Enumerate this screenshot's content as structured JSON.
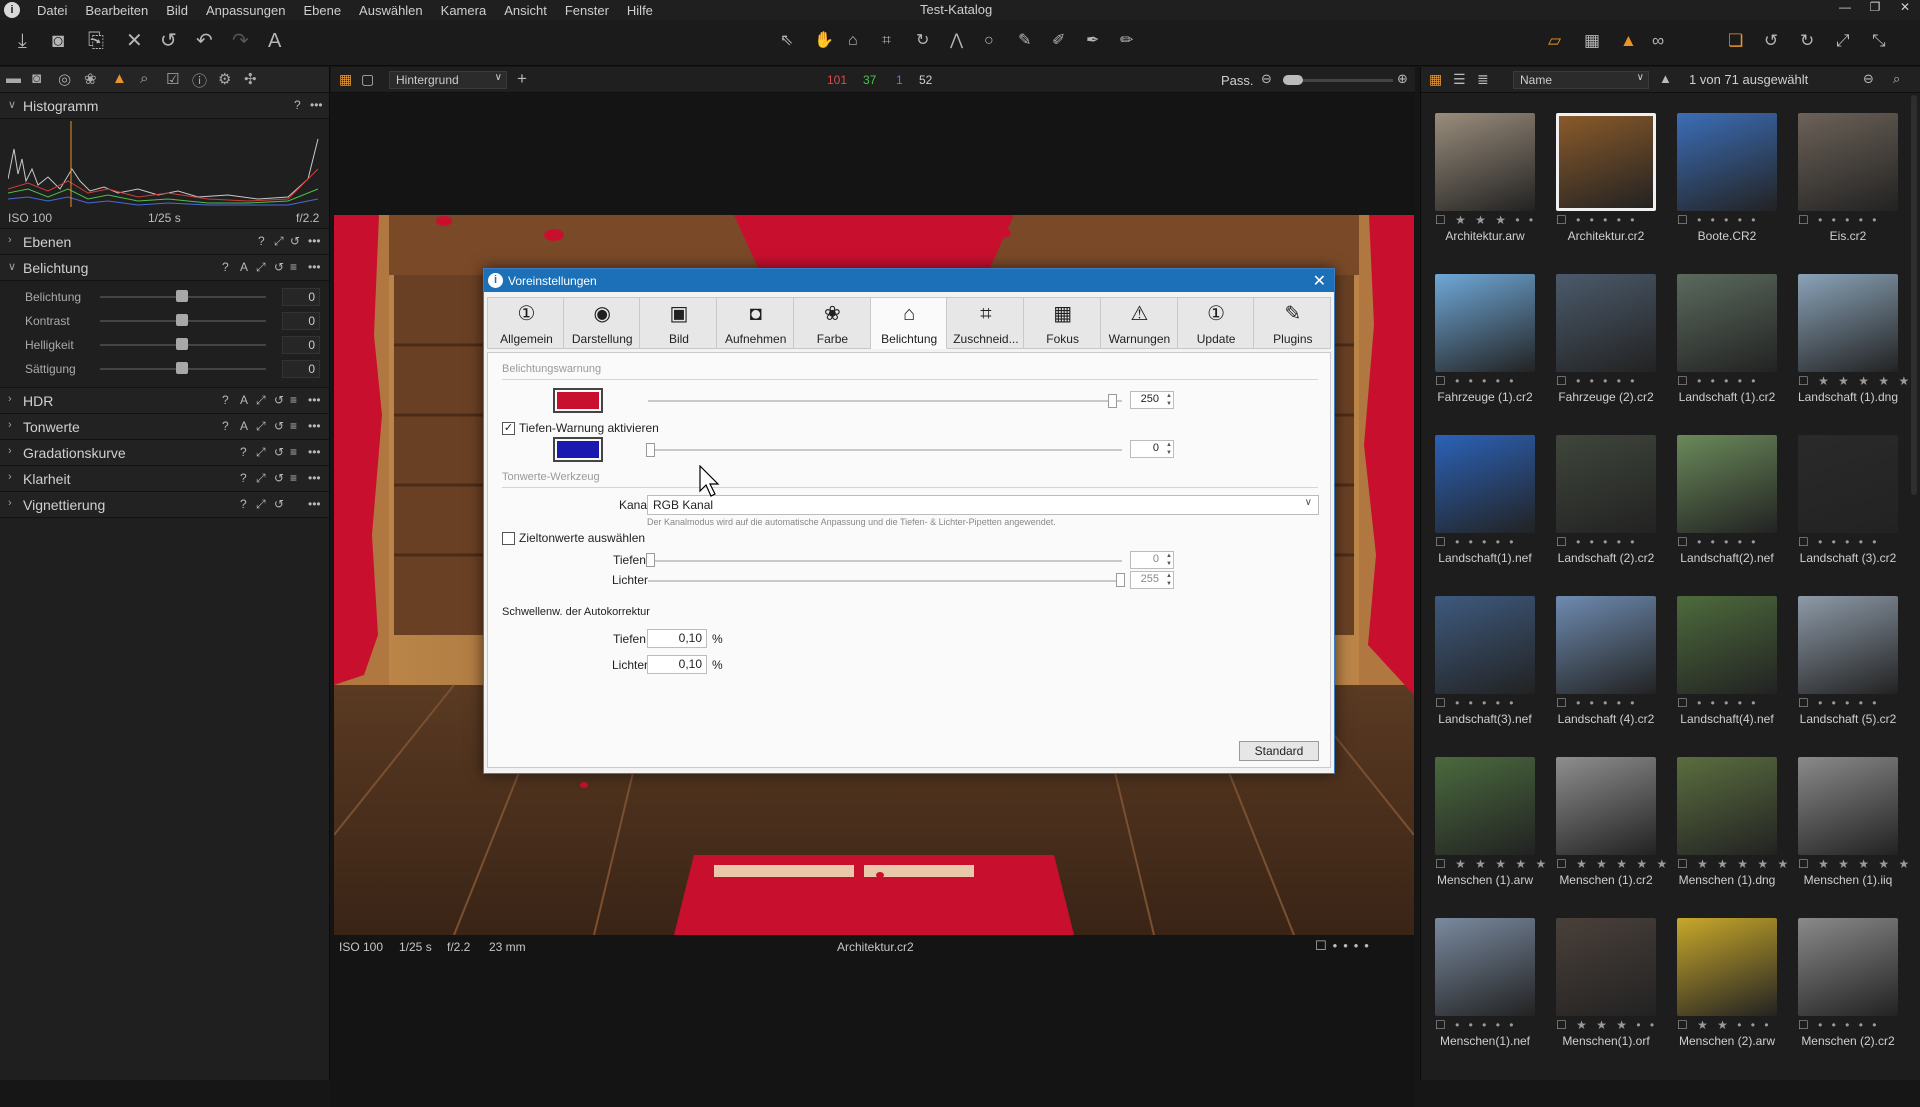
{
  "window": {
    "title": "Test-Katalog"
  },
  "menu": [
    "Datei",
    "Bearbeiten",
    "Bild",
    "Anpassungen",
    "Ebene",
    "Auswählen",
    "Kamera",
    "Ansicht",
    "Fenster",
    "Hilfe"
  ],
  "left": {
    "histogram": {
      "title": "Histogramm",
      "iso": "ISO 100",
      "shutter": "1/25 s",
      "aperture": "f/2.2"
    },
    "sections": {
      "ebenen": "Ebenen",
      "belichtung": "Belichtung",
      "hdr": "HDR",
      "tonwerte": "Tonwerte",
      "gradation": "Gradationskurve",
      "klarheit": "Klarheit",
      "vignettierung": "Vignettierung"
    },
    "exposure": [
      {
        "label": "Belichtung",
        "value": "0"
      },
      {
        "label": "Kontrast",
        "value": "0"
      },
      {
        "label": "Helligkeit",
        "value": "0"
      },
      {
        "label": "Sättigung",
        "value": "0"
      }
    ]
  },
  "viewer": {
    "style_select": "Hintergrund",
    "counts": {
      "red": "101",
      "green": "37",
      "blue": "1",
      "gray": "52"
    },
    "zoom_label": "Pass.",
    "info": {
      "iso": "ISO 100",
      "shutter": "1/25 s",
      "aperture": "f/2.2",
      "focal": "23 mm",
      "filename": "Architektur.cr2"
    },
    "clip_colors": {
      "highlight": "#c8102e"
    }
  },
  "browser": {
    "sort": "Name",
    "selection": "1 von 71 ausgewählt",
    "thumbs": [
      {
        "name": "Architektur.arw",
        "rating": "☐ ★ ★ ★ • •",
        "selected": false
      },
      {
        "name": "Architektur.cr2",
        "rating": "☐ • • • • •",
        "selected": true
      },
      {
        "name": "Boote.CR2",
        "rating": "☐ • • • • •",
        "selected": false
      },
      {
        "name": "Eis.cr2",
        "rating": "☐ • • • • •",
        "selected": false
      },
      {
        "name": "Fahrzeuge (1).cr2",
        "rating": "☐ • • • • •",
        "selected": false
      },
      {
        "name": "Fahrzeuge (2).cr2",
        "rating": "☐ • • • • •",
        "selected": false
      },
      {
        "name": "Landschaft (1).cr2",
        "rating": "☐ • • • • •",
        "selected": false
      },
      {
        "name": "Landschaft (1).dng",
        "rating": "☐ ★ ★ ★ ★ ★",
        "selected": false
      },
      {
        "name": "Landschaft(1).nef",
        "rating": "☐ • • • • •",
        "selected": false
      },
      {
        "name": "Landschaft (2).cr2",
        "rating": "☐ • • • • •",
        "selected": false
      },
      {
        "name": "Landschaft(2).nef",
        "rating": "☐ • • • • •",
        "selected": false
      },
      {
        "name": "Landschaft (3).cr2",
        "rating": "☐ • • • • •",
        "selected": false
      },
      {
        "name": "Landschaft(3).nef",
        "rating": "☐ • • • • •",
        "selected": false
      },
      {
        "name": "Landschaft (4).cr2",
        "rating": "☐ • • • • •",
        "selected": false
      },
      {
        "name": "Landschaft(4).nef",
        "rating": "☐ • • • • •",
        "selected": false
      },
      {
        "name": "Landschaft (5).cr2",
        "rating": "☐ • • • • •",
        "selected": false
      },
      {
        "name": "Menschen (1).arw",
        "rating": "☐ ★ ★ ★ ★ ★",
        "selected": false
      },
      {
        "name": "Menschen (1).cr2",
        "rating": "☐ ★ ★ ★ ★ ★",
        "selected": false
      },
      {
        "name": "Menschen (1).dng",
        "rating": "☐ ★ ★ ★ ★ ★",
        "selected": false
      },
      {
        "name": "Menschen (1).iiq",
        "rating": "☐ ★ ★ ★ ★ ★",
        "selected": false
      },
      {
        "name": "Menschen(1).nef",
        "rating": "☐ • • • • •",
        "selected": false
      },
      {
        "name": "Menschen(1).orf",
        "rating": "☐ ★ ★ ★ • •",
        "selected": false
      },
      {
        "name": "Menschen (2).arw",
        "rating": "☐ ★ ★ • • •",
        "selected": false
      },
      {
        "name": "Menschen (2).cr2",
        "rating": "☐ • • • • •",
        "selected": false
      }
    ],
    "thumb_colors": [
      "#9a8d7c",
      "#8a5a2a",
      "#3c6eb8",
      "#6c6258",
      "#6fa8d8",
      "#4b5a6b",
      "#5b6a5d",
      "#8aa3b8",
      "#2b62b8",
      "#3f463b",
      "#6a8a5a",
      "#2a2a2a",
      "#3e5a7e",
      "#6e8bb0",
      "#4d6b3c",
      "#8d9aa8",
      "#4a6a3e",
      "#8e8e8e",
      "#5b6e3f",
      "#8a8a8a",
      "#7a8aa0",
      "#4a403a",
      "#c8a82a",
      "#8a8a8a"
    ]
  },
  "dialog": {
    "title": "Voreinstellungen",
    "tabs": [
      {
        "label": "Allgemein",
        "icon": "①"
      },
      {
        "label": "Darstellung",
        "icon": "◉"
      },
      {
        "label": "Bild",
        "icon": "▣"
      },
      {
        "label": "Aufnehmen",
        "icon": "◘"
      },
      {
        "label": "Farbe",
        "icon": "❀"
      },
      {
        "label": "Belichtung",
        "icon": "⌂"
      },
      {
        "label": "Zuschneid...",
        "icon": "⌗"
      },
      {
        "label": "Fokus",
        "icon": "▦"
      },
      {
        "label": "Warnungen",
        "icon": "⚠"
      },
      {
        "label": "Update",
        "icon": "①"
      },
      {
        "label": "Plugins",
        "icon": "✎"
      }
    ],
    "active_tab": 5,
    "exposure_warning": {
      "group": "Belichtungswarnung",
      "highlight_value": "250",
      "highlight_color": "#c8102e",
      "highlight_level": 0.98,
      "shadow_checkbox": "Tiefen-Warnung aktivieren",
      "shadow_checked": true,
      "shadow_value": "0",
      "shadow_color": "#1a1ab0",
      "shadow_level": 0.0
    },
    "levels_tool": {
      "group": "Tonwerte-Werkzeug",
      "channel_label": "Kanal",
      "channel_value": "RGB Kanal",
      "hint": "Der Kanalmodus wird auf die automatische Anpassung und die Tiefen- & Lichter-Pipetten angewendet.",
      "target_checkbox": "Zieltonwerte auswählen",
      "target_checked": false,
      "shadows_label": "Tiefen",
      "shadows_value": "0",
      "highlights_label": "Lichter",
      "highlights_value": "255"
    },
    "auto_threshold": {
      "title": "Schwellenw. der Autokorrektur",
      "shadows_label": "Tiefen",
      "shadows_value": "0,10",
      "highlights_label": "Lichter",
      "highlights_value": "0,10",
      "unit": "%"
    },
    "default_button": "Standard"
  }
}
